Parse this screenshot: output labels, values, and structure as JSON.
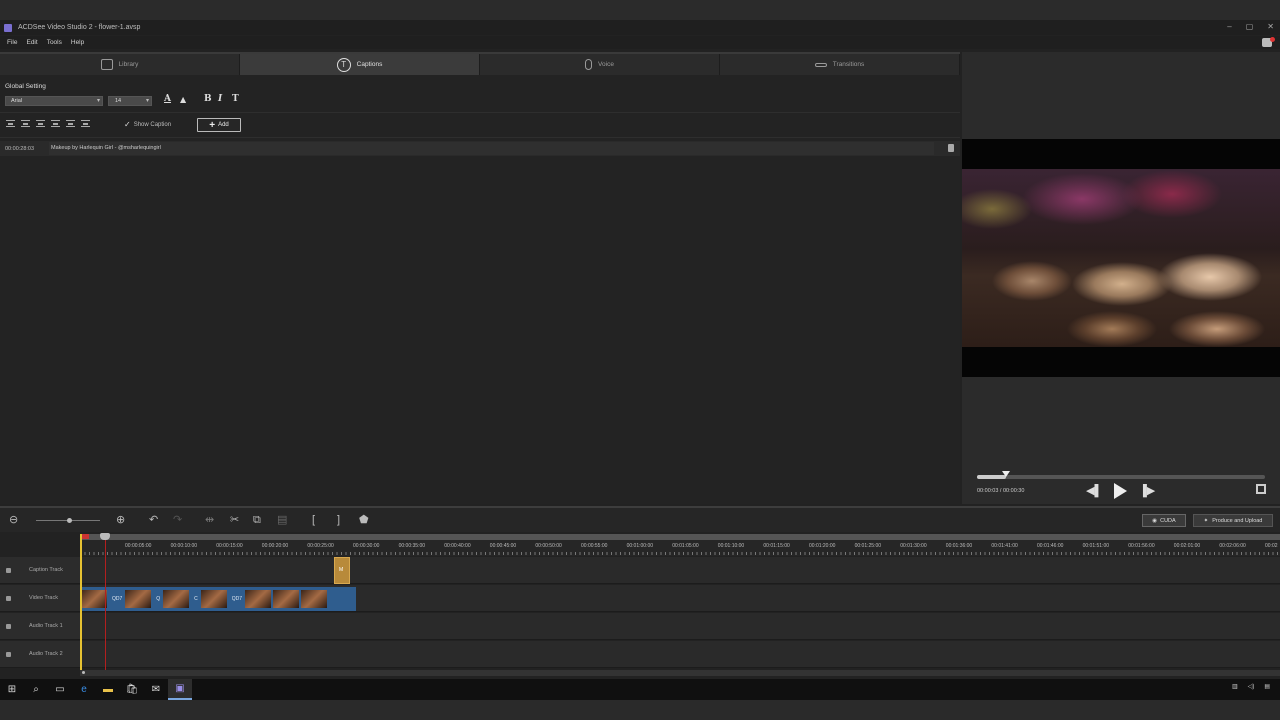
{
  "window": {
    "title": "ACDSee Video Studio 2 - flower-1.avsp",
    "min_icon": "minimize-icon",
    "max_icon": "maximize-icon",
    "close_icon": "close-icon"
  },
  "menu": [
    "File",
    "Edit",
    "Tools",
    "Help"
  ],
  "tabs": [
    {
      "label": "Library",
      "icon": "library-icon",
      "active": false
    },
    {
      "label": "Captions",
      "icon": "captions-icon",
      "active": true
    },
    {
      "label": "Voice",
      "icon": "microphone-icon",
      "active": false
    },
    {
      "label": "Transitions",
      "icon": "transitions-icon",
      "active": false
    }
  ],
  "captions_panel": {
    "global_setting_label": "Global Setting",
    "font": "Arial",
    "size": "14",
    "show_caption_label": "Show Caption",
    "show_caption_checked": true,
    "add_label": "Add",
    "captions": [
      {
        "time": "00:00:28:03",
        "text": "Makeup by Harlequin Girl - @msharlequingirl"
      }
    ]
  },
  "preview": {
    "time_readout": "00:00:03 / 00:00:30",
    "progress": 0.1
  },
  "timeline_toolbar": {
    "cuda_label": "CUDA",
    "produce_label": "Produce and Upload"
  },
  "ruler": [
    "00:00:05:00",
    "00:00:10:00",
    "00:00:15:00",
    "00:00:20:00",
    "00:00:25:00",
    "00:00:30:00",
    "00:00:35:00",
    "00:00:40:00",
    "00:00:45:00",
    "00:00:50:00",
    "00:00:55:00",
    "00:01:00:00",
    "00:01:05:00",
    "00:01:10:00",
    "00:01:15:00",
    "00:01:20:00",
    "00:01:25:00",
    "00:01:30:00",
    "00:01:36:00",
    "00:01:41:00",
    "00:01:46:00",
    "00:01:51:00",
    "00:01:56:00",
    "00:02:01:00",
    "00:02:06:00",
    "00:02"
  ],
  "tracks": [
    {
      "name": "Caption Track"
    },
    {
      "name": "Video Track"
    },
    {
      "name": "Audio Track 1"
    },
    {
      "name": "Audio Track 2"
    }
  ],
  "caption_clip_label": "M",
  "video_clip_labels": [
    "QD7",
    "Q",
    "C",
    "QD7"
  ],
  "colors": {
    "accent_playhead": "#e6c232",
    "video_clip": "#2f5d8e",
    "caption_clip": "#b88a3a"
  }
}
